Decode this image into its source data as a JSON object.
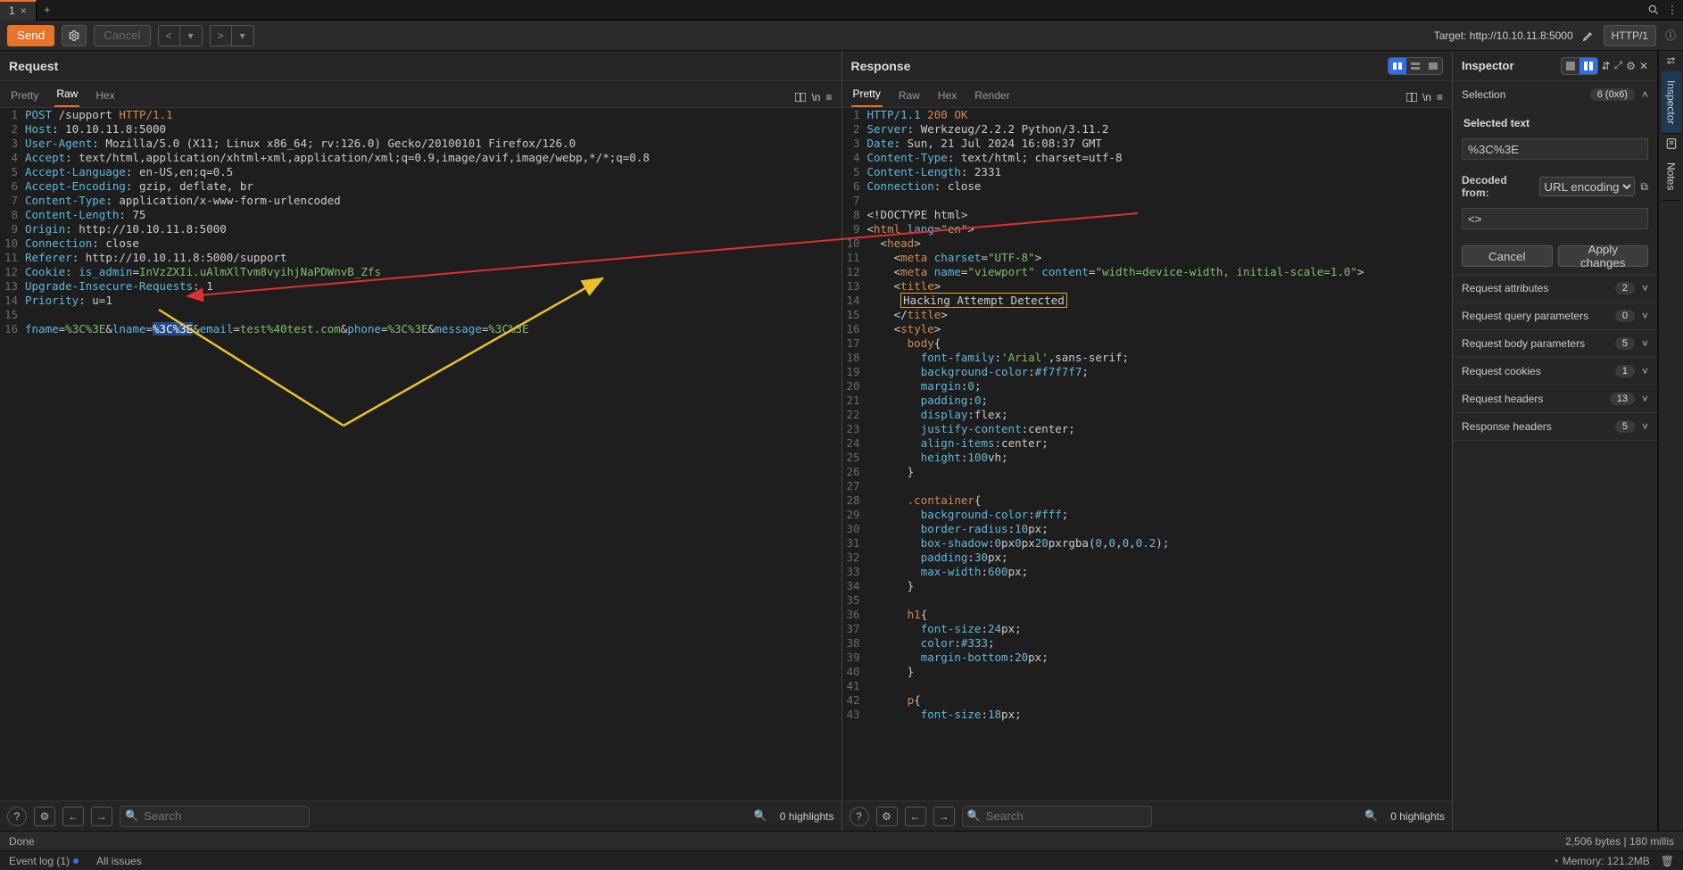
{
  "topTabs": {
    "items": [
      {
        "label": "1",
        "active": true
      }
    ]
  },
  "toolbar": {
    "send": "Send",
    "cancel": "Cancel",
    "target_label": "Target: ",
    "target_url": "http://10.10.11.8:5000",
    "http_proto": "HTTP/1"
  },
  "request": {
    "title": "Request",
    "tabs": [
      "Pretty",
      "Raw",
      "Hex"
    ],
    "activeTab": 1,
    "wrap": "\\n",
    "menu": "≡",
    "lines": [
      {
        "n": 1,
        "html": "<span class='key'>POST</span> <span>/support</span> <span class='kw'>HTTP/1.1</span>"
      },
      {
        "n": 2,
        "html": "<span class='key'>Host</span>: 10.10.11.8:5000"
      },
      {
        "n": 3,
        "html": "<span class='key'>User-Agent</span>: Mozilla/5.0 (X11; Linux x86_64; rv:126.0) Gecko/20100101 Firefox/126.0"
      },
      {
        "n": 4,
        "html": "<span class='key'>Accept</span>: text/html,application/xhtml+xml,application/xml;q=0.9,image/avif,image/webp,*/*;q=0.8"
      },
      {
        "n": 5,
        "html": "<span class='key'>Accept-Language</span>: en-US,en;q=0.5"
      },
      {
        "n": 6,
        "html": "<span class='key'>Accept-Encoding</span>: gzip, deflate, br"
      },
      {
        "n": 7,
        "html": "<span class='key'>Content-Type</span>: application/x-www-form-urlencoded"
      },
      {
        "n": 8,
        "html": "<span class='key'>Content-Length</span>: 75"
      },
      {
        "n": 9,
        "html": "<span class='key'>Origin</span>: http://10.10.11.8:5000"
      },
      {
        "n": 10,
        "html": "<span class='key'>Connection</span>: close"
      },
      {
        "n": 11,
        "html": "<span class='key'>Referer</span>: http://10.10.11.8:5000/support"
      },
      {
        "n": 12,
        "html": "<span class='key'>Cookie</span>: <span class='key'>is_admin</span>=<span class='str'>InVzZXIi.uAlmXlTvm8vyihjNaPDWnvB_Zfs</span>"
      },
      {
        "n": 13,
        "html": "<span class='key'>Upgrade-Insecure-Requests</span>: 1"
      },
      {
        "n": 14,
        "html": "<span class='key'>Priority</span>: u=1"
      },
      {
        "n": 15,
        "html": ""
      },
      {
        "n": 16,
        "html": "<span class='key'>fname</span>=<span class='str'>%3C%3E</span>&amp;<span class='key'>lname</span>=<span class='str sel'>%3C%3E</span>&amp;<span class='key'>email</span>=<span class='str'>test%40test.com</span>&amp;<span class='key'>phone</span>=<span class='str'>%3C%3E</span>&amp;<span class='key'>message</span>=<span class='str'>%3C%3E</span>"
      }
    ]
  },
  "response": {
    "title": "Response",
    "tabs": [
      "Pretty",
      "Raw",
      "Hex",
      "Render"
    ],
    "activeTab": 0,
    "lines": [
      {
        "n": 1,
        "html": "<span class='key'>HTTP/1.1</span> <span class='kw'>200 OK</span>"
      },
      {
        "n": 2,
        "html": "<span class='key'>Server</span>: Werkzeug/2.2.2 Python/3.11.2"
      },
      {
        "n": 3,
        "html": "<span class='key'>Date</span>: Sun, 21 Jul 2024 16:08:37 GMT"
      },
      {
        "n": 4,
        "html": "<span class='key'>Content-Type</span>: text/html; charset=utf-8"
      },
      {
        "n": 5,
        "html": "<span class='key'>Content-Length</span>: 2331"
      },
      {
        "n": 6,
        "html": "<span class='key'>Connection</span>: close"
      },
      {
        "n": 7,
        "html": ""
      },
      {
        "n": 8,
        "html": "&lt;!DOCTYPE html&gt;"
      },
      {
        "n": 9,
        "html": "&lt;<span class='val'>html</span> <span class='key'>lang</span>=<span class='str'>\"en\"</span>&gt;"
      },
      {
        "n": 10,
        "html": "  &lt;<span class='val'>head</span>&gt;"
      },
      {
        "n": 11,
        "html": "    &lt;<span class='val'>meta</span> <span class='key'>charset</span>=<span class='str'>\"UTF-8\"</span>&gt;"
      },
      {
        "n": 12,
        "html": "    &lt;<span class='val'>meta</span> <span class='key'>name</span>=<span class='str'>\"viewport\"</span> <span class='key'>content</span>=<span class='str'>\"width=device-width, initial-scale=1.0\"</span>&gt;"
      },
      {
        "n": 13,
        "html": "    &lt;<span class='val'>title</span>&gt;"
      },
      {
        "n": 14,
        "html": "     <span class='highlight-box'>Hacking Attempt Detected</span>"
      },
      {
        "n": 15,
        "html": "    &lt;/<span class='val'>title</span>&gt;"
      },
      {
        "n": 16,
        "html": "    &lt;<span class='val'>style</span>&gt;"
      },
      {
        "n": 17,
        "html": "      <span class='val'>body</span>{"
      },
      {
        "n": 18,
        "html": "        <span class='key'>font-family</span>:<span class='str'>'Arial'</span>,sans-serif;"
      },
      {
        "n": 19,
        "html": "        <span class='key'>background-color</span>:<span class='lit'>#f7f7f7</span>;"
      },
      {
        "n": 20,
        "html": "        <span class='key'>margin</span>:<span class='lit'>0</span>;"
      },
      {
        "n": 21,
        "html": "        <span class='key'>padding</span>:<span class='lit'>0</span>;"
      },
      {
        "n": 22,
        "html": "        <span class='key'>display</span>:flex;"
      },
      {
        "n": 23,
        "html": "        <span class='key'>justify-content</span>:center;"
      },
      {
        "n": 24,
        "html": "        <span class='key'>align-items</span>:center;"
      },
      {
        "n": 25,
        "html": "        <span class='key'>height</span>:<span class='lit'>100</span>vh;"
      },
      {
        "n": 26,
        "html": "      }"
      },
      {
        "n": 27,
        "html": ""
      },
      {
        "n": 28,
        "html": "      <span class='val'>.container</span>{"
      },
      {
        "n": 29,
        "html": "        <span class='key'>background-color</span>:<span class='lit'>#fff</span>;"
      },
      {
        "n": 30,
        "html": "        <span class='key'>border-radius</span>:<span class='lit'>10</span>px;"
      },
      {
        "n": 31,
        "html": "        <span class='key'>box-shadow</span>:<span class='lit'>0</span>px<span class='lit'>0</span>px<span class='lit'>20</span>px<span>rgba</span>(<span class='lit'>0</span>,<span class='lit'>0</span>,<span class='lit'>0</span>,<span class='lit'>0.2</span>);"
      },
      {
        "n": 32,
        "html": "        <span class='key'>padding</span>:<span class='lit'>30</span>px;"
      },
      {
        "n": 33,
        "html": "        <span class='key'>max-width</span>:<span class='lit'>600</span>px;"
      },
      {
        "n": 34,
        "html": "      }"
      },
      {
        "n": 35,
        "html": ""
      },
      {
        "n": 36,
        "html": "      <span class='val'>h1</span>{"
      },
      {
        "n": 37,
        "html": "        <span class='key'>font-size</span>:<span class='lit'>24</span>px;"
      },
      {
        "n": 38,
        "html": "        <span class='key'>color</span>:<span class='lit'>#333</span>;"
      },
      {
        "n": 39,
        "html": "        <span class='key'>margin-bottom</span>:<span class='lit'>20</span>px;"
      },
      {
        "n": 40,
        "html": "      }"
      },
      {
        "n": 41,
        "html": ""
      },
      {
        "n": 42,
        "html": "      <span class='val'>p</span>{"
      },
      {
        "n": 43,
        "html": "        <span class='key'>font-size</span>:<span class='lit'>18</span>px;"
      }
    ]
  },
  "search": {
    "placeholder": "Search",
    "highlights": "0 highlights"
  },
  "inspector": {
    "title": "Inspector",
    "selection": {
      "label": "Selection",
      "count": "6 (0x6)"
    },
    "selected_text_label": "Selected text",
    "selected_text_value": "%3C%3E",
    "decoded_label": "Decoded from:",
    "decoded_encoding": "URL encoding",
    "decoded_value": "<>",
    "cancel": "Cancel",
    "apply": "Apply changes",
    "sections": [
      {
        "label": "Request attributes",
        "count": "2"
      },
      {
        "label": "Request query parameters",
        "count": "0"
      },
      {
        "label": "Request body parameters",
        "count": "5"
      },
      {
        "label": "Request cookies",
        "count": "1"
      },
      {
        "label": "Request headers",
        "count": "13"
      },
      {
        "label": "Response headers",
        "count": "5"
      }
    ]
  },
  "rail": {
    "inspector": "Inspector",
    "notes": "Notes"
  },
  "status": {
    "done": "Done",
    "bytes": "2,506 bytes | 180 millis",
    "eventlog": "Event log (1)",
    "issues": "All issues",
    "memory": "Memory: 121.2MB"
  }
}
